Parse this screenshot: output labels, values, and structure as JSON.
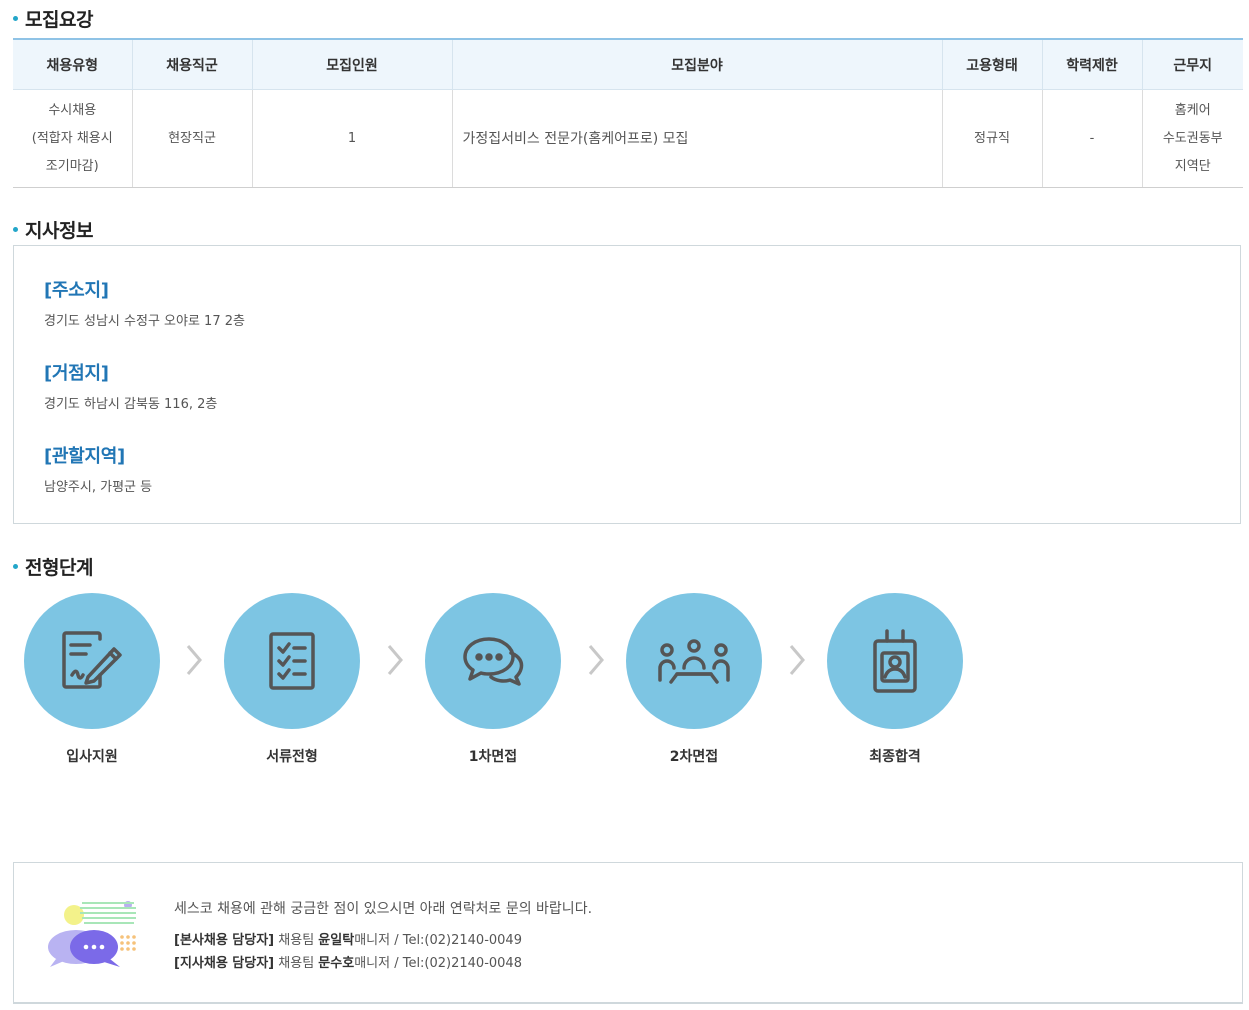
{
  "sections": {
    "recruit": "모집요강",
    "branch": "지사정보",
    "process": "전형단계"
  },
  "table": {
    "headers": [
      "채용유형",
      "채용직군",
      "모집인원",
      "모집분야",
      "고용형태",
      "학력제한",
      "근무지"
    ],
    "row": {
      "type_lines": [
        "수시채용",
        "(적합자 채용시",
        "조기마감)"
      ],
      "job_group": "현장직군",
      "headcount": "1",
      "field": "가정집서비스 전문가(홈케어프로) 모집",
      "employment": "정규직",
      "education": "-",
      "location_lines": [
        "홈케어",
        "수도권동부",
        "지역단"
      ]
    }
  },
  "branch": {
    "address_title": "[주소지]",
    "address": "경기도 성남시 수정구 오야로 17 2층",
    "base_title": "[거점지]",
    "base": "경기도 하남시 감북동 116, 2층",
    "region_title": "[관할지역]",
    "region": "남양주시, 가평군 등"
  },
  "steps": [
    {
      "label": "입사지원",
      "icon": "apply-form-icon"
    },
    {
      "label": "서류전형",
      "icon": "checklist-icon"
    },
    {
      "label": "1차면접",
      "icon": "chat-bubbles-icon"
    },
    {
      "label": "2차면접",
      "icon": "meeting-icon"
    },
    {
      "label": "최종합격",
      "icon": "id-badge-icon"
    }
  ],
  "contact": {
    "intro": "세스코 채용에 관해 궁금한 점이 있으시면 아래 연락처로 문의 바랍니다.",
    "hq_label": "[본사채용 담당자]",
    "hq_team": " 채용팀 ",
    "hq_name": "윤일탁",
    "hq_rest": "매니저 / Tel:(02)2140-0049",
    "branch_label": "[지사채용 담당자]",
    "branch_team": " 채용팀 ",
    "branch_name": "문수호",
    "branch_rest": "매니저 / Tel:(02)2140-0048"
  },
  "colors": {
    "accent": "#2176b5",
    "circle": "#7dc5e3",
    "table_header_bg": "#eef6fc"
  }
}
